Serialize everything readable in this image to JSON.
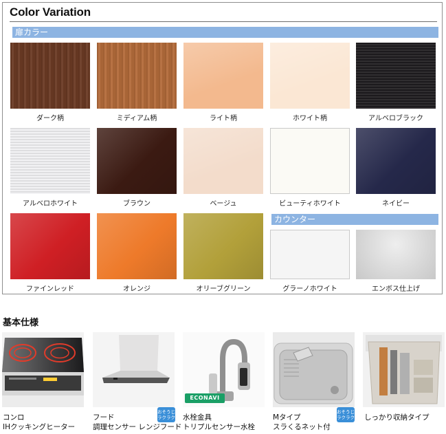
{
  "color_variation": {
    "title": "Color Variation",
    "door_color_label": "扉カラー",
    "counter_label": "カウンター",
    "door_swatches": [
      {
        "label": "ダーク柄",
        "color": "#6b3a24"
      },
      {
        "label": "ミディアム柄",
        "color": "#b36b3a"
      },
      {
        "label": "ライト柄",
        "color": "#f3b98e"
      },
      {
        "label": "ホワイト柄",
        "color": "#fbe7d4"
      },
      {
        "label": "アルベロブラック",
        "color": "#1e1c1f"
      },
      {
        "label": "アルベロホワイト",
        "color": "#f1f1f3"
      },
      {
        "label": "ブラウン",
        "color": "#3b1a12"
      },
      {
        "label": "ベージュ",
        "color": "#f3dccb"
      },
      {
        "label": "ビューティホワイト",
        "color": "#fbfaf5"
      },
      {
        "label": "ネイビー",
        "color": "#25284a"
      },
      {
        "label": "ファインレッド",
        "color": "#cf1f24"
      },
      {
        "label": "オレンジ",
        "color": "#ee7a2a"
      },
      {
        "label": "オリーブグリーン",
        "color": "#b2a03a"
      }
    ],
    "counter_swatches": [
      {
        "label": "グラーノホワイト",
        "color": "#f5f5f5"
      },
      {
        "label": "エンボス仕上げ",
        "color": "#d8d8d8"
      }
    ]
  },
  "basic_spec": {
    "title": "基本仕様",
    "items": [
      {
        "line1": "コンロ",
        "line2": "IHクッキングヒーター"
      },
      {
        "line1": "フード",
        "line2": "調理センサー レンジフード",
        "badge": "おそうじラクラク"
      },
      {
        "line1": "水栓金具",
        "line2": "トリプルセンサー水栓",
        "logo": "ECONAVI"
      },
      {
        "line1": "Mタイプ",
        "line2": "スラくるネット付",
        "badge": "おそうじラクラク"
      },
      {
        "line1": "しっかり収納タイプ",
        "line2": ""
      }
    ]
  }
}
